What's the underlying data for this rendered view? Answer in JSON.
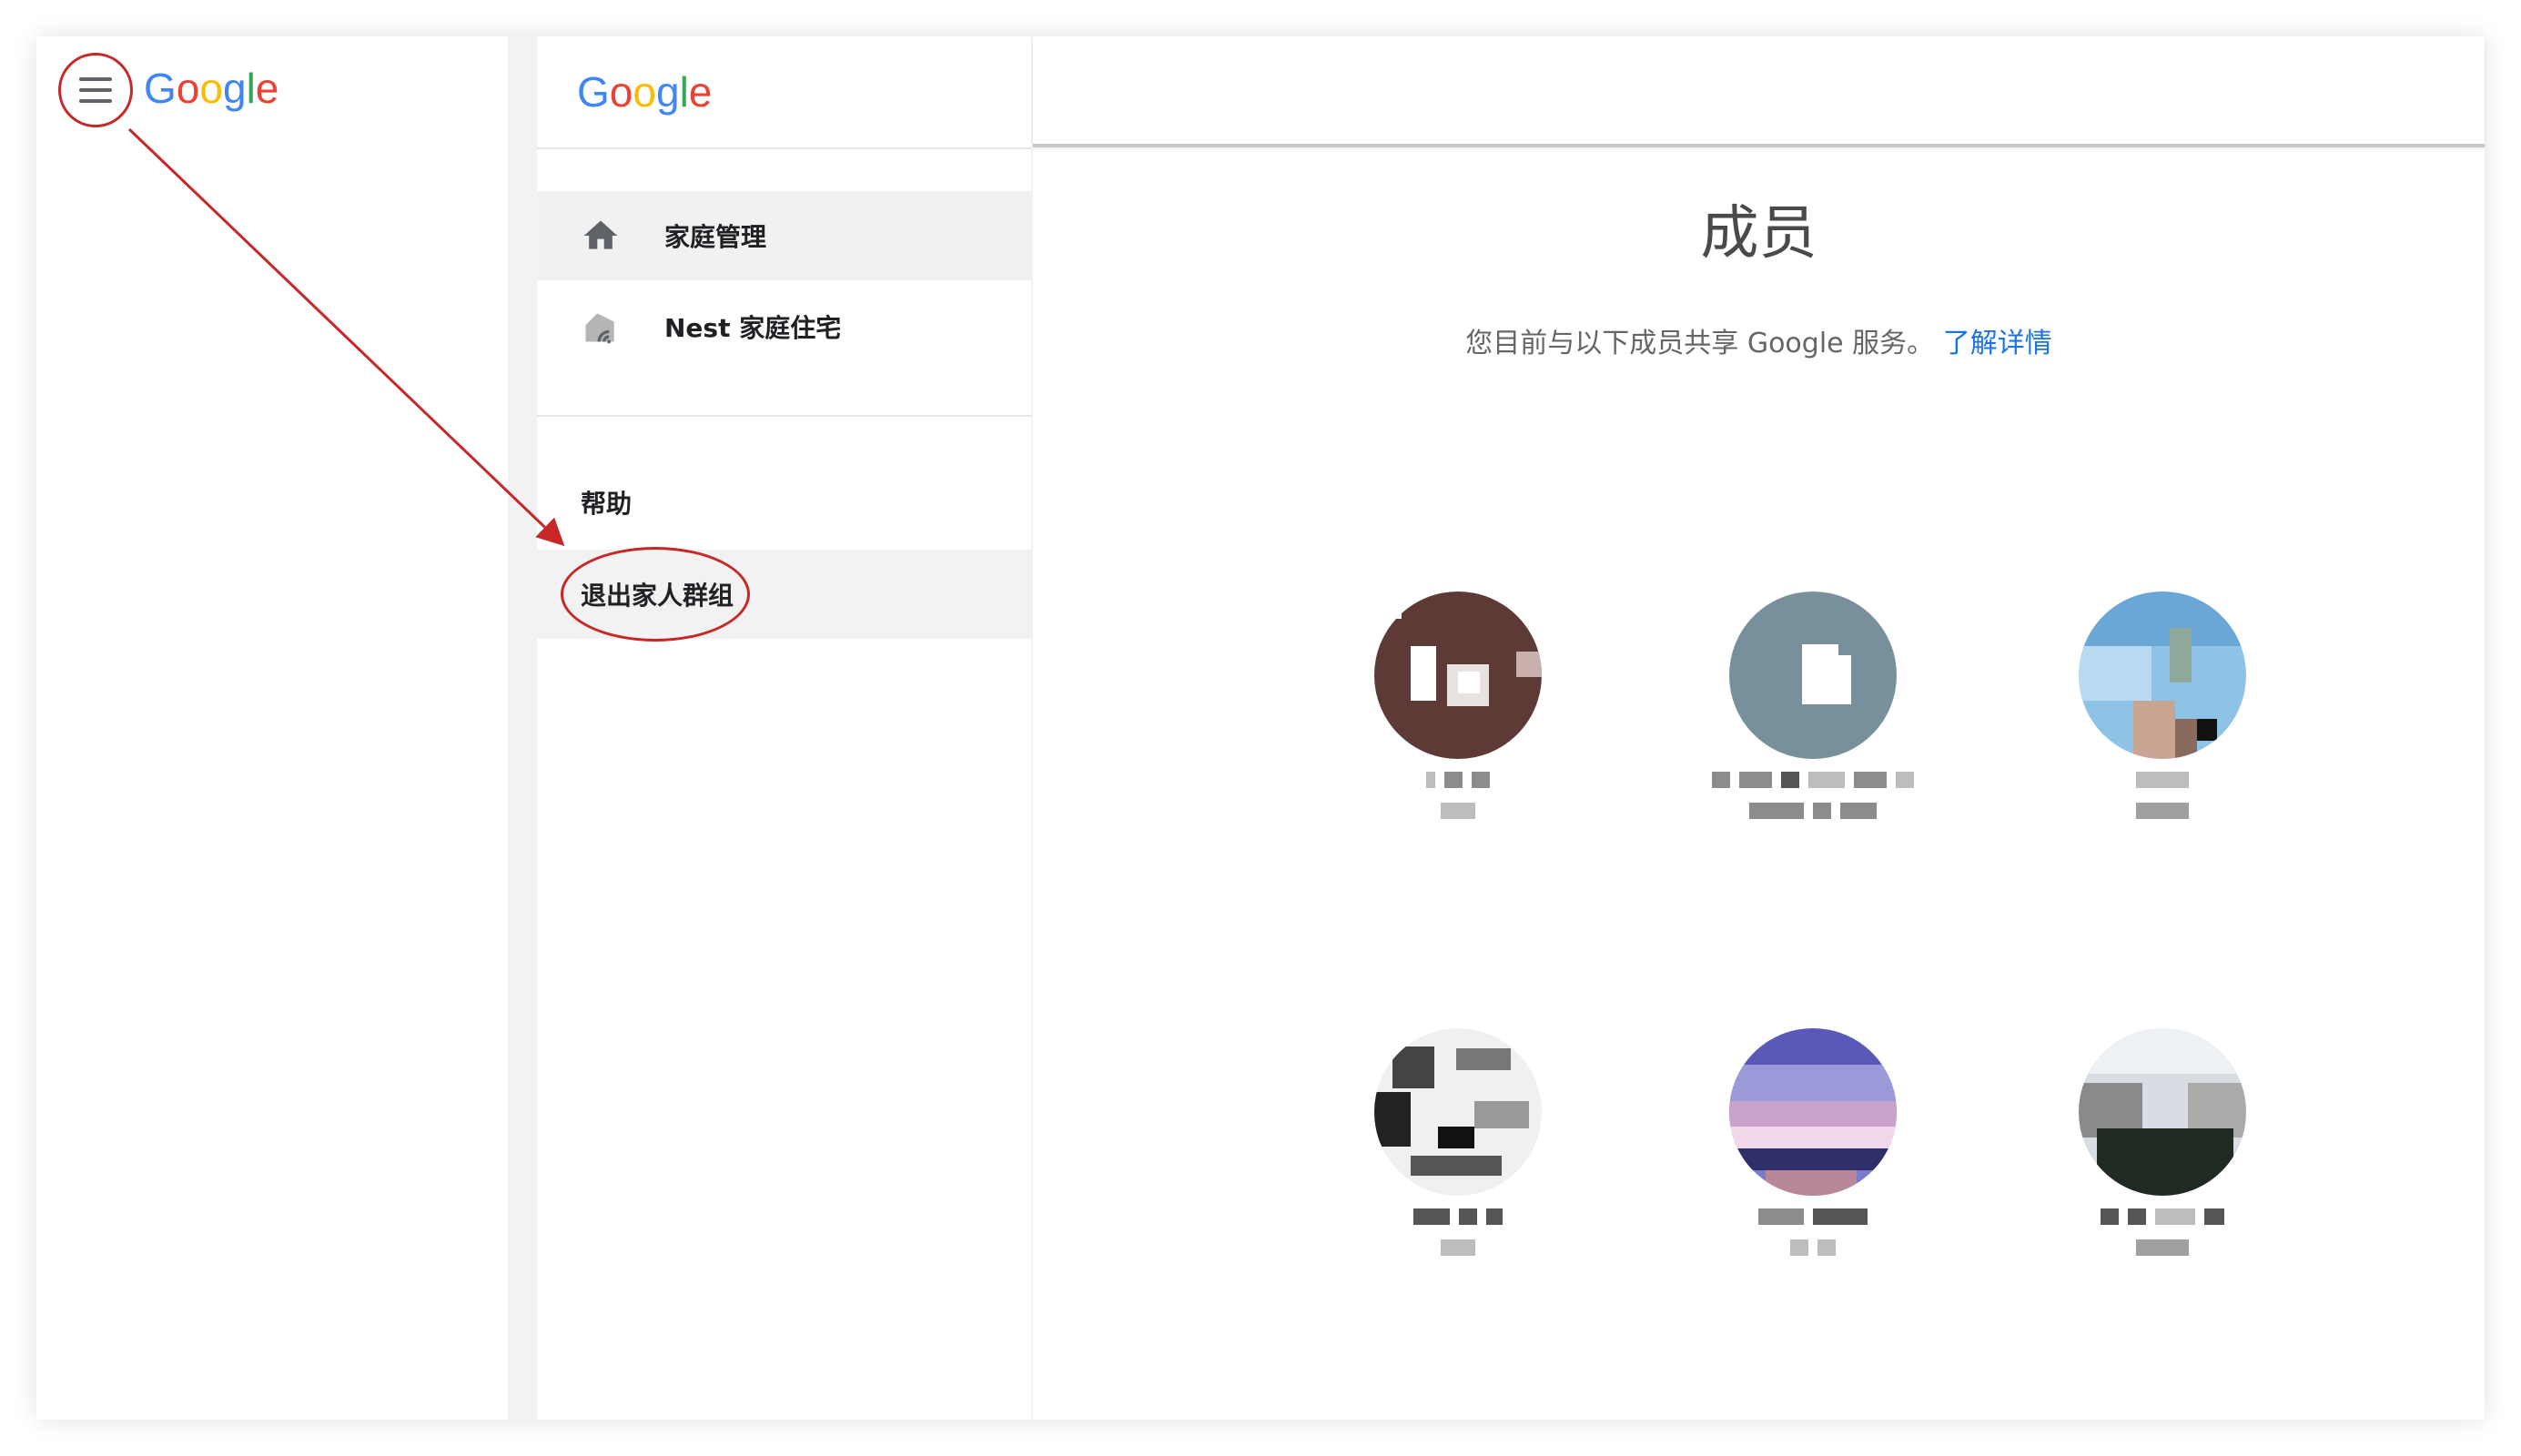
{
  "left_page": {
    "logo": {
      "g1": "G",
      "o1": "o",
      "o2": "o",
      "g2": "g",
      "l": "l",
      "e": "e"
    }
  },
  "drawer": {
    "logo": {
      "g1": "G",
      "o1": "o",
      "o2": "o",
      "g2": "g",
      "l": "l",
      "e": "e"
    },
    "items": [
      {
        "label": "家庭管理",
        "icon": "home-icon"
      },
      {
        "label": "Nest 家庭住宅",
        "icon": "nest-home-icon"
      }
    ],
    "help_label": "帮助",
    "leave_label": "退出家人群组"
  },
  "main": {
    "title": "成员",
    "subtitle": "您目前与以下成员共享 Google 服务。",
    "learn_more": "了解详情"
  },
  "colors": {
    "google_blue": "#4285F4",
    "google_red": "#EA4335",
    "google_yellow": "#FBBC05",
    "google_green": "#34A853",
    "link": "#1a73e8",
    "annotation": "#c62828"
  }
}
